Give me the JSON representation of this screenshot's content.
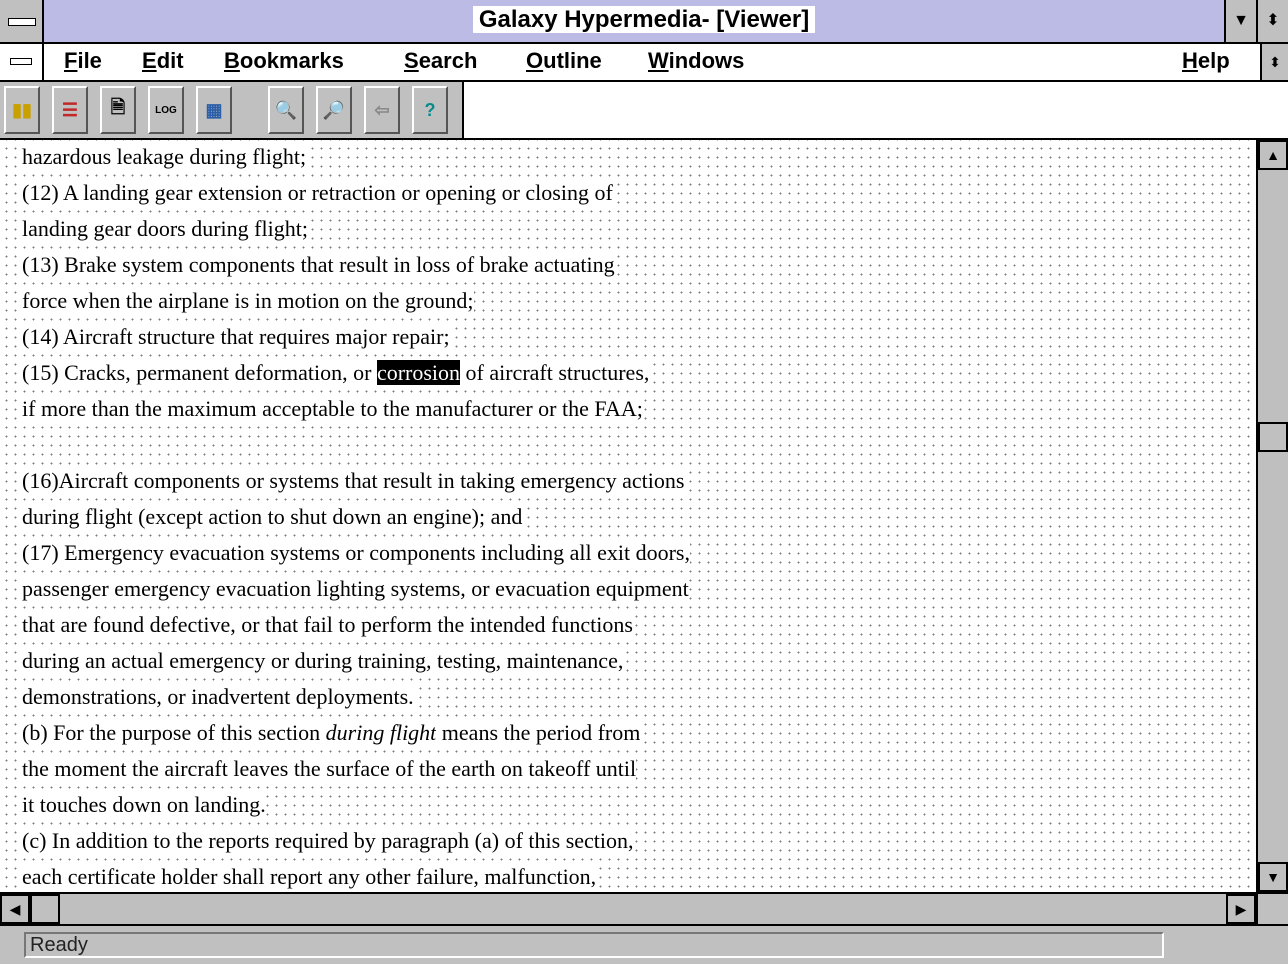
{
  "window": {
    "title": "Galaxy Hypermedia- [Viewer]",
    "minimize_glyph": "▼",
    "maximize_glyph": "⬍"
  },
  "menu": {
    "items": [
      {
        "label": "File",
        "accel": "F",
        "rest": "ile"
      },
      {
        "label": "Edit",
        "accel": "E",
        "rest": "dit"
      },
      {
        "label": "Bookmarks",
        "accel": "B",
        "rest": "ookmarks"
      },
      {
        "label": "Search",
        "accel": "S",
        "rest": "earch"
      },
      {
        "label": "Outline",
        "accel": "O",
        "rest": "utline"
      },
      {
        "label": "Windows",
        "accel": "W",
        "rest": "indows"
      },
      {
        "label": "Help",
        "accel": "H",
        "rest": "elp"
      }
    ],
    "restore_glyph": "⬍"
  },
  "toolbar": {
    "buttons": [
      {
        "icon": "library-books-icon",
        "glyph": "▮▮"
      },
      {
        "icon": "table-of-contents-icon",
        "glyph": "☰"
      },
      {
        "icon": "document-icon",
        "glyph": "🗎"
      },
      {
        "icon": "log-icon",
        "label": "LOG"
      },
      {
        "icon": "window-tile-icon",
        "glyph": "▦"
      },
      {
        "icon": "search-icon",
        "glyph": "🔍"
      },
      {
        "icon": "search-next-icon",
        "glyph": "🔎"
      },
      {
        "icon": "back-arrow-icon",
        "glyph": "⇦"
      },
      {
        "icon": "help-icon",
        "glyph": "?"
      }
    ]
  },
  "document": {
    "lines": [
      {
        "text": "hazardous leakage during flight;"
      },
      {
        "text": "(12) A landing gear extension or retraction or opening or closing of"
      },
      {
        "text": "landing gear doors during flight;"
      },
      {
        "text": "(13) Brake system components that result in loss of brake actuating"
      },
      {
        "text": "force when the airplane is in motion on the ground;"
      },
      {
        "text": "(14) Aircraft structure that requires major repair;"
      },
      {
        "before": "(15) Cracks, permanent deformation, or ",
        "highlight": "corrosion",
        "after": " of aircraft structures,"
      },
      {
        "text": "if more than the maximum acceptable to the manufacturer or the FAA;"
      },
      {
        "text": ""
      },
      {
        "text": "(16)Aircraft components or systems that result in taking emergency actions"
      },
      {
        "text": "during flight (except action to shut down an engine); and"
      },
      {
        "text": "(17) Emergency evacuation systems or components including all exit doors,"
      },
      {
        "text": "passenger emergency evacuation lighting systems, or evacuation equipment"
      },
      {
        "text": "that are found defective, or that fail to perform the intended functions"
      },
      {
        "text": "during an actual emergency or during training, testing, maintenance,"
      },
      {
        "text": "demonstrations, or inadvertent deployments."
      },
      {
        "before": "(b) For the purpose of this section ",
        "italic": "during flight",
        "after": " means the period from"
      },
      {
        "text": "the moment the aircraft leaves the surface of the earth on takeoff until"
      },
      {
        "text": "it touches down on landing."
      },
      {
        "text": "(c) In addition to the reports required by paragraph (a) of this section,"
      },
      {
        "text": "each certificate holder shall report any other failure, malfunction,"
      }
    ],
    "vertical_scroll_position": 0.38,
    "horizontal_scroll_position": 0.0
  },
  "scroll": {
    "up_glyph": "▲",
    "down_glyph": "▼",
    "left_glyph": "◀",
    "right_glyph": "▶"
  },
  "status": {
    "text": "Ready"
  }
}
